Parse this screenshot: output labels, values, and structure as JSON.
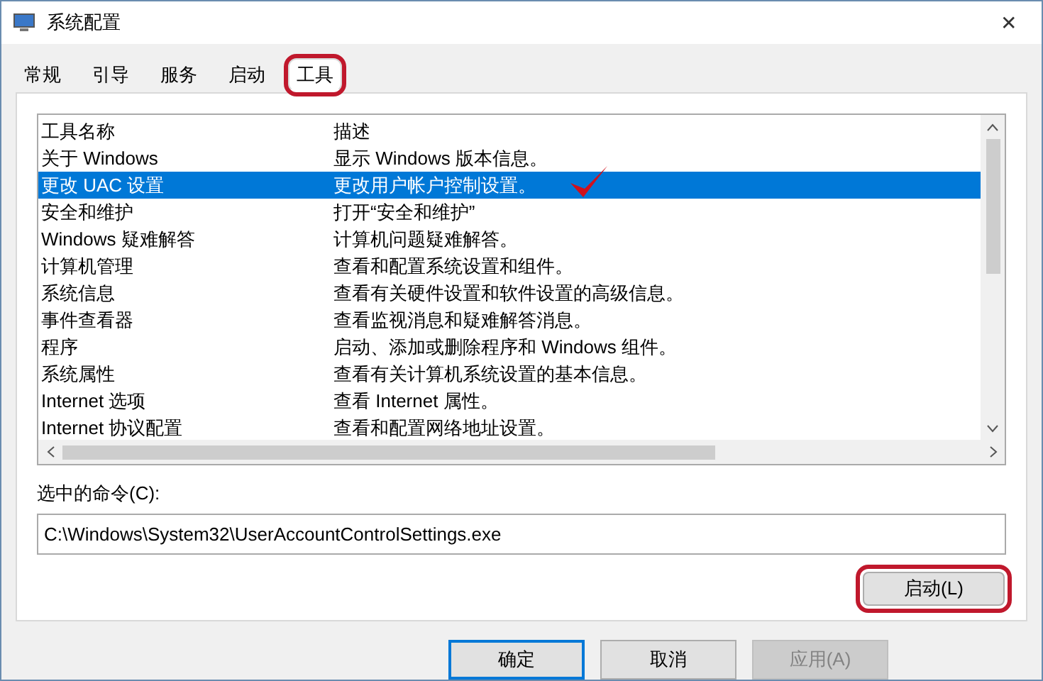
{
  "window": {
    "title": "系统配置",
    "close": "✕"
  },
  "tabs": [
    {
      "label": "常规",
      "selected": false,
      "circled": false
    },
    {
      "label": "引导",
      "selected": false,
      "circled": false
    },
    {
      "label": "服务",
      "selected": false,
      "circled": false
    },
    {
      "label": "启动",
      "selected": false,
      "circled": false
    },
    {
      "label": "工具",
      "selected": true,
      "circled": true
    }
  ],
  "table": {
    "columns": [
      "工具名称",
      "描述"
    ],
    "rows": [
      {
        "name": "关于 Windows",
        "description": "显示 Windows 版本信息。",
        "selected": false,
        "ticked": false
      },
      {
        "name": "更改 UAC 设置",
        "description": "更改用户帐户控制设置。",
        "selected": true,
        "ticked": true
      },
      {
        "name": "安全和维护",
        "description": "打开“安全和维护”",
        "selected": false,
        "ticked": false
      },
      {
        "name": "Windows 疑难解答",
        "description": "计算机问题疑难解答。",
        "selected": false,
        "ticked": false
      },
      {
        "name": "计算机管理",
        "description": "查看和配置系统设置和组件。",
        "selected": false,
        "ticked": false
      },
      {
        "name": "系统信息",
        "description": "查看有关硬件设置和软件设置的高级信息。",
        "selected": false,
        "ticked": false
      },
      {
        "name": "事件查看器",
        "description": "查看监视消息和疑难解答消息。",
        "selected": false,
        "ticked": false
      },
      {
        "name": "程序",
        "description": "启动、添加或删除程序和 Windows 组件。",
        "selected": false,
        "ticked": false
      },
      {
        "name": "系统属性",
        "description": "查看有关计算机系统设置的基本信息。",
        "selected": false,
        "ticked": false
      },
      {
        "name": "Internet 选项",
        "description": "查看 Internet 属性。",
        "selected": false,
        "ticked": false
      },
      {
        "name": "Internet 协议配置",
        "description": "查看和配置网络地址设置。",
        "selected": false,
        "ticked": false
      }
    ]
  },
  "command": {
    "label": "选中的命令(C):",
    "value": "C:\\Windows\\System32\\UserAccountControlSettings.exe"
  },
  "launch_button": {
    "label": "启动(L)",
    "circled": true
  },
  "buttons": [
    {
      "label": "确定",
      "default": true,
      "disabled": false
    },
    {
      "label": "取消",
      "default": false,
      "disabled": false
    },
    {
      "label": "应用(A)",
      "default": false,
      "disabled": true
    }
  ]
}
